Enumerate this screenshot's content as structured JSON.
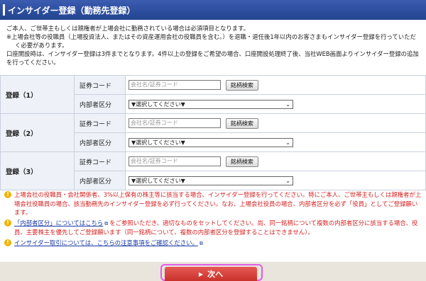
{
  "header": {
    "title": "インサイダー登録（勤務先登録）"
  },
  "intro": {
    "line1": "ご本人、ご世帯主もしくは親権者が上場会社に勤務されている場合は必須項目となります。",
    "line2": "※上場会社等の役職員（上場投資法人、またはその資産運用会社の役職員を含む。）を退職・退任後1年以内のお客さまもインサイダー登録を行っていただ",
    "line3": "く必要があります。",
    "line4": "口座開設時は、インサイダー登録は3件までとなります。4件以上の登録をご希望の場合、口座開設処理終了後、当社WEB画面よりインサイダー登録の追加",
    "line5": "を行ってください。"
  },
  "registrations": [
    {
      "title": "登録（1）",
      "code_label": "証券コード",
      "code_placeholder": "会社名/証券コード",
      "search_label": "銘柄検索",
      "category_label": "内部者区分",
      "category_value": "▼選択してください▼"
    },
    {
      "title": "登録（2）",
      "code_label": "証券コード",
      "code_placeholder": "会社名/証券コード",
      "search_label": "銘柄検索",
      "category_label": "内部者区分",
      "category_value": "▼選択してください▼"
    },
    {
      "title": "登録（3）",
      "code_label": "証券コード",
      "code_placeholder": "会社名/証券コード",
      "search_label": "銘柄検索",
      "category_label": "内部者区分",
      "category_value": "▼選択してください▼"
    }
  ],
  "notes": {
    "icon": "!",
    "note1": "上場会社の役職員・会社関係者、3%以上保有の株主等に該当する場合、インサイダー登録を行ってください。特にご本人、ご世帯主もしくは親権者が上場会社役職員の場合、該当勤務先のインサイダー登録を必ず行ってください。なお、上場会社役員の場合、内部者区分を必ず「役員」としてご登録願います。",
    "note2_link": "「内部者区分」についてはこちら",
    "note2_text": "をご参照いただき、適切なものをセットしてください。尚、同一銘柄について複数の内部者区分に該当する場合、役員、主要株主を優先してご登録願います（同一銘柄について、複数の内部者区分を登録することはできません）。",
    "note3_link": "インサイダー取引については、こちらの注意事項をご確認ください。"
  },
  "footer": {
    "next_label": "次へ"
  },
  "colors": {
    "header": "#22438f",
    "red_text": "#d41f1f",
    "next_button": "#d9403a",
    "highlight": "#e25be8"
  }
}
